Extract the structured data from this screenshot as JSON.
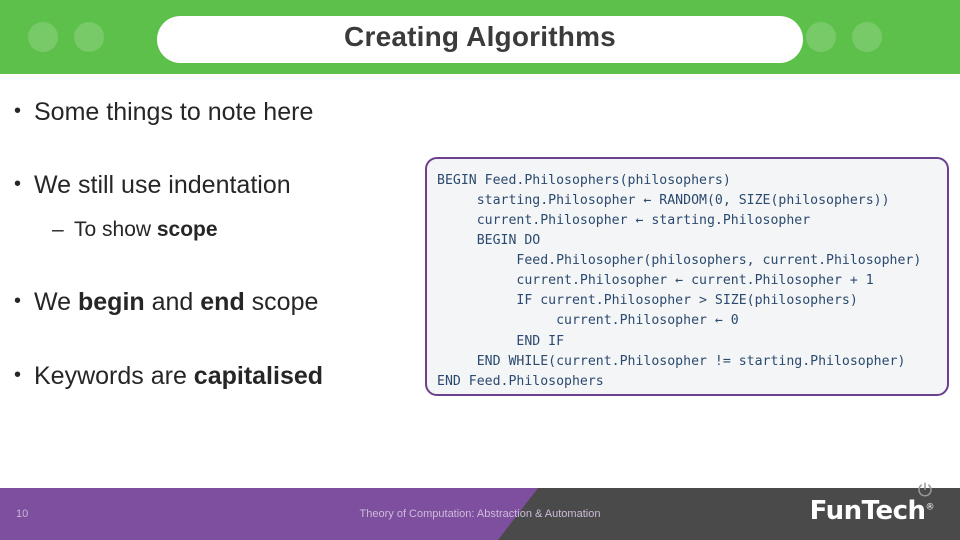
{
  "slide": {
    "title": "Creating Algorithms",
    "bullets": [
      {
        "text": "Some things to note here"
      },
      {
        "text": "We still use indentation"
      },
      {
        "text": "We begin and end scope"
      },
      {
        "text": "Keywords are capitalised"
      }
    ],
    "bullet2_parts": {
      "plain1": "We ",
      "bold1": "begin",
      "plain2": " and ",
      "bold2": "end",
      "plain3": " scope"
    },
    "bullet3_parts": {
      "plain1": "Keywords are ",
      "bold1": "capitalised"
    },
    "sub_bullet": {
      "plain1": "To show ",
      "bold1": "scope"
    },
    "code": "BEGIN Feed.Philosophers(philosophers)\n     starting.Philosopher ← RANDOM(0, SIZE(philosophers))\n     current.Philosopher ← starting.Philosopher\n     BEGIN DO\n          Feed.Philosopher(philosophers, current.Philosopher)\n          current.Philosopher ← current.Philosopher + 1\n          IF current.Philosopher > SIZE(philosophers)\n               current.Philosopher ← 0\n          END IF\n     END WHILE(current.Philosopher != starting.Philosopher)\nEND Feed.Philosophers",
    "footer": {
      "page_number": "10",
      "caption": "Theory of Computation: Abstraction & Automation",
      "logo_text": "FunTech",
      "logo_mark": "®"
    },
    "colors": {
      "header_green": "#5dc04a",
      "slide_purple": "#7d4f9e",
      "code_border": "#6c3f8f",
      "code_text": "#2b4a6f"
    }
  }
}
